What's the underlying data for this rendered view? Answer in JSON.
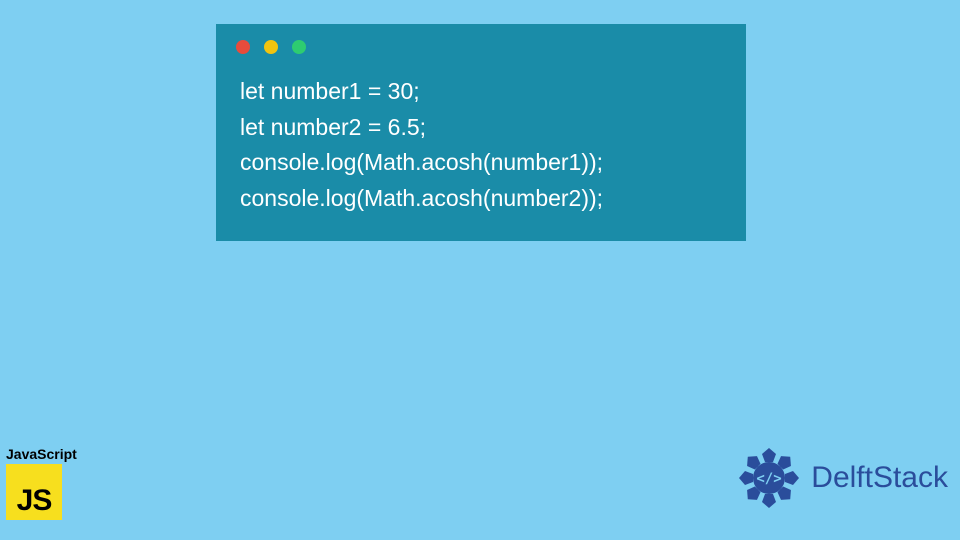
{
  "code_window": {
    "lines": [
      "let number1 = 30;",
      "let number2 = 6.5;",
      "console.log(Math.acosh(number1));",
      "console.log(Math.acosh(number2));"
    ]
  },
  "js_badge": {
    "label": "JavaScript",
    "logo_text": "JS"
  },
  "brand": {
    "name": "DelftStack"
  },
  "colors": {
    "background": "#7ecff2",
    "code_bg": "#1a8ca8",
    "code_text": "#ffffff",
    "js_yellow": "#f7df1e",
    "brand_blue": "#2a4d9b"
  }
}
